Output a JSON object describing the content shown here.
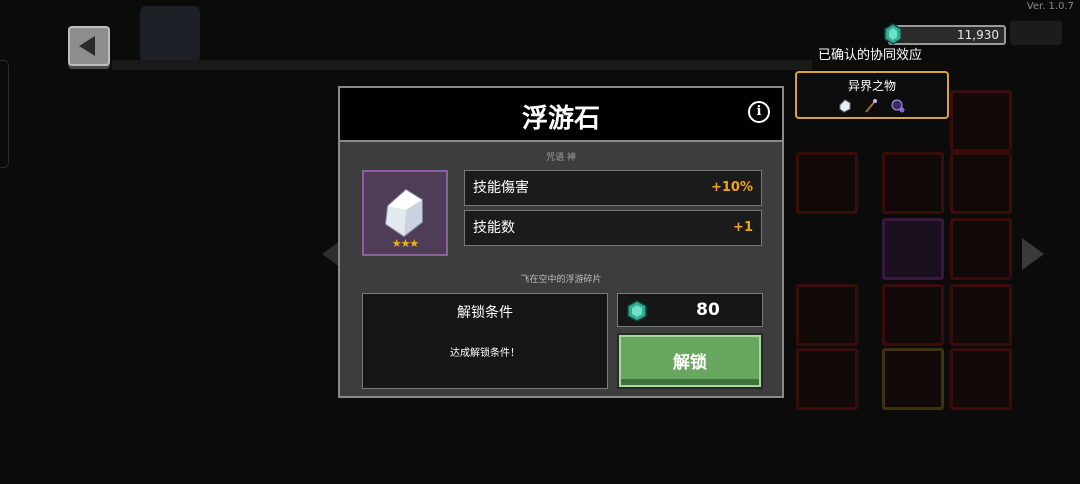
{
  "hud": {
    "version": "Ver. 1.0.7",
    "gems": "11,930",
    "synergy_label": "已确认的协同效应",
    "synergy_name": "异界之物",
    "synergy_icons": [
      "crystal-icon",
      "staff-icon",
      "orb-icon"
    ]
  },
  "modal": {
    "title": "浮游石",
    "tags": "咒语  神",
    "rarity_stars": "★★★",
    "stats": [
      {
        "label": "技能傷害",
        "value": "+10%"
      },
      {
        "label": "技能数",
        "value": "+1"
      }
    ],
    "description": "飞在空中的浮游碎片",
    "condition_title": "解锁条件",
    "condition_text": "达成解锁条件！",
    "cost": "80",
    "unlock_label": "解锁"
  },
  "colors": {
    "accent_gold": "#f0a41c",
    "unlock_green": "#67a760",
    "rarity_purple": "#8b5fa0",
    "synergy_border": "#d8a53a"
  }
}
